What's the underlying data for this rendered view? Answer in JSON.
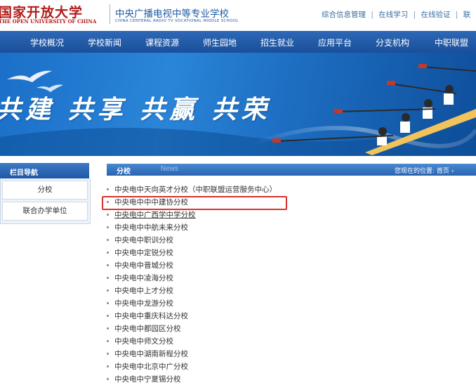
{
  "header": {
    "logo_cn": "国家开放大学",
    "logo_en": "THE OPEN UNIVERSITY OF CHINA",
    "school_cn": "中央广播电视中等专业学校",
    "school_en": "CHINA CENTERAL RADIO TV VOCATIONAL MIDDLE SCHOOL",
    "links": [
      "综合信息管理",
      "在线学习",
      "在线验证",
      "联"
    ],
    "separator": "|"
  },
  "nav": {
    "items": [
      "学校概况",
      "学校新闻",
      "课程资源",
      "师生园地",
      "招生就业",
      "应用平台",
      "分支机构",
      "中职联盟"
    ]
  },
  "banner": {
    "slogan": "共建 共享 共赢 共荣"
  },
  "sidebar": {
    "title": "栏目导航",
    "items": [
      "分校",
      "联合办学单位"
    ]
  },
  "content": {
    "tab_active": "分校",
    "tab_news": "News",
    "breadcrumb_label": "您现在的位置:",
    "breadcrumb_home": "首页",
    "breadcrumb_sep": "›",
    "items": [
      "中央电中天向英才分校（中职联盟运营服务中心）",
      "中央电中中中建协分校",
      "中央电中广西学中学分校",
      "中央电中中航未来分校",
      "中央电中职训分校",
      "中央电中定锐分校",
      "中央电中晋城分校",
      "中央电中凌海分校",
      "中央电中上才分校",
      "中央电中龙游分校",
      "中央电中重庆科达分校",
      "中央电中都园区分校",
      "中央电中师文分校",
      "中央电中湖南新程分校",
      "中央电中北京中广分校",
      "中央电中宁夏锡分校"
    ]
  },
  "colors": {
    "brand_red": "#b31b1b",
    "nav_blue": "#1f58a6",
    "highlight_red": "#d6332c"
  }
}
